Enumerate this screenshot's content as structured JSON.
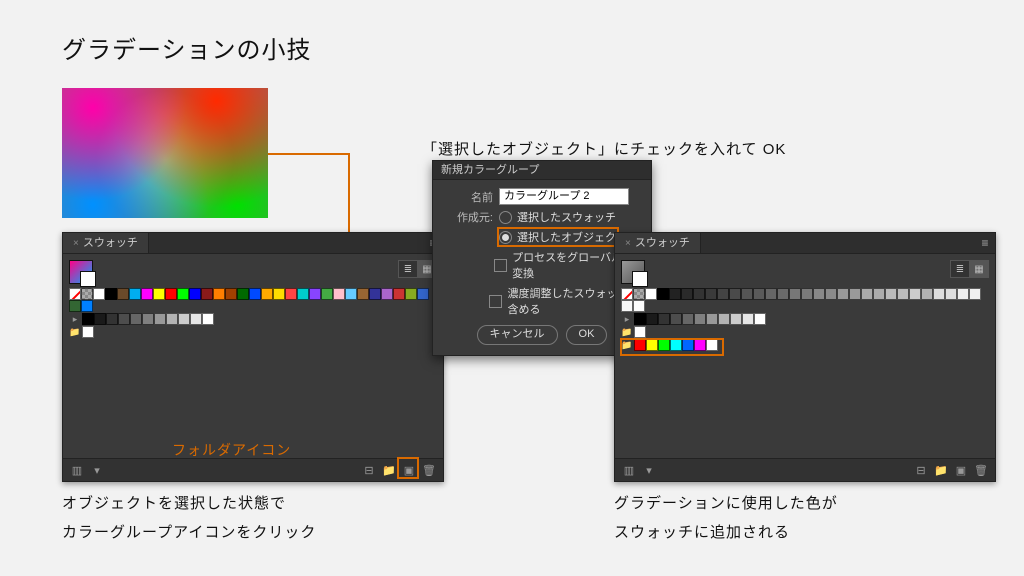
{
  "title": "グラデーションの小技",
  "panel_left": {
    "tab": "スウォッチ",
    "row1": [
      "none",
      "reg",
      "#ffffff",
      "#000000",
      "#6a4a2a",
      "#00aeef",
      "#ff00ff",
      "#ffff00",
      "#ff0000",
      "#00ff00",
      "#0000ff",
      "#8a1a1a",
      "#ff7f00",
      "#a04000",
      "#006a00",
      "#004aff",
      "#ffaa00",
      "#ffdd00",
      "#ff4444",
      "#00cccc",
      "#8844ff",
      "#44aa44",
      "#ffc0cb",
      "#66ccff",
      "#996633",
      "#333399",
      "#aa66cc",
      "#cc3333",
      "#88aa22",
      "#3366cc",
      "#336633",
      "#0080ff"
    ],
    "row2_lead": "▸",
    "row2": [
      "#000000",
      "#1a1a1a",
      "#333333",
      "#4d4d4d",
      "#666666",
      "#808080",
      "#999999",
      "#b3b3b3",
      "#cccccc",
      "#e6e6e6",
      "#ffffff"
    ],
    "row3_lead": "📁",
    "row3": [
      "#ffffff"
    ]
  },
  "panel_right": {
    "tab": "スウォッチ",
    "row1": [
      "none",
      "reg",
      "#ffffff",
      "#000000",
      "#222222",
      "#2a2a2a",
      "#333333",
      "#3a3a3a",
      "#444444",
      "#4a4a4a",
      "#555555",
      "#5a5a5a",
      "#666666",
      "#6a6a6a",
      "#777777",
      "#7a7a7a",
      "#888888",
      "#8a8a8a",
      "#999999",
      "#9a9a9a",
      "#aaaaaa",
      "#acacac",
      "#bbbbbb",
      "#bcbcbc",
      "#cccccc",
      "#cececece",
      "#dddddd",
      "#dedede",
      "#eeeeee",
      "#f0f0f0",
      "#f7f7f7",
      "#fcfcfc"
    ],
    "row2_lead": "▸",
    "row2": [
      "#000000",
      "#1a1a1a",
      "#333333",
      "#4d4d4d",
      "#666666",
      "#808080",
      "#999999",
      "#b3b3b3",
      "#cccccc",
      "#e6e6e6",
      "#ffffff"
    ],
    "row3_lead": "📁",
    "row3": [
      "#ffffff"
    ],
    "row4_lead": "📁",
    "row4": [
      "#ff0000",
      "#ffff00",
      "#00ff00",
      "#00ffff",
      "#0066ff",
      "#ff00ff",
      "#ffffff"
    ]
  },
  "dialog": {
    "title": "新規カラーグループ",
    "name_label": "名前",
    "name_value": "カラーグループ 2",
    "source_label": "作成元:",
    "opt_swatch": "選択したスウォッチ",
    "opt_object": "選択したオブジェクト",
    "chk_global": "プロセスをグローバルに変換",
    "chk_tint": "濃度調整したスウォッチを含める",
    "cancel": "キャンセル",
    "ok": "OK"
  },
  "ann_top": "「選択したオブジェクト」にチェックを入れて OK",
  "ann_folder": "フォルダアイコン",
  "ann_left1": "オブジェクトを選択した状態で",
  "ann_left2": "カラーグループアイコンをクリック",
  "ann_right1": "グラデーションに使用した色が",
  "ann_right2": "スウォッチに追加される"
}
